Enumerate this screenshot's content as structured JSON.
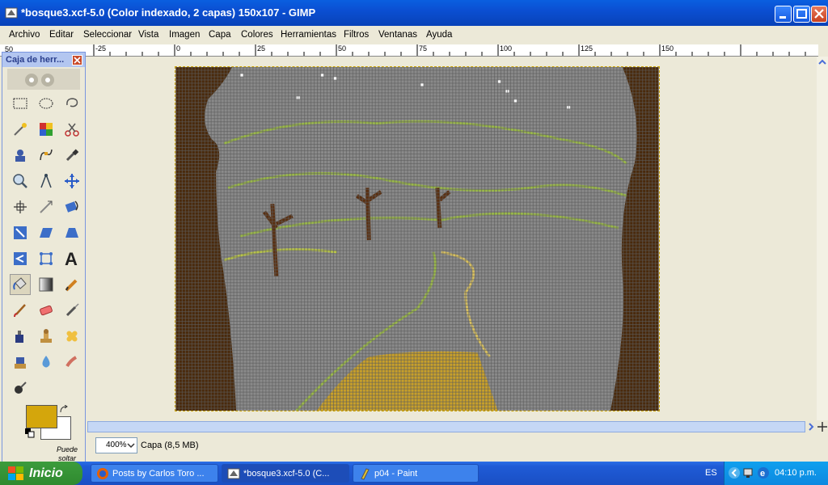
{
  "window": {
    "title": "*bosque3.xcf-5.0 (Color indexado, 2 capas) 150x107 - GIMP"
  },
  "menubar": {
    "items": [
      "Archivo",
      "Editar",
      "Seleccionar",
      "Vista",
      "Imagen",
      "Capa",
      "Colores",
      "Herramientas",
      "Filtros",
      "Ventanas",
      "Ayuda"
    ]
  },
  "ruler": {
    "ticks": [
      "-25",
      "0",
      "25",
      "50",
      "75",
      "100",
      "125",
      "150"
    ]
  },
  "vruler": {
    "label": "50"
  },
  "toolbox": {
    "title": "Caja de herr...",
    "drop_hint": "Puede soltar",
    "fg_color": "#d4a60c",
    "bg_color": "#ffffff"
  },
  "status": {
    "zoom": "400%",
    "layer_info": "Capa (8,5 MB)"
  },
  "taskbar": {
    "start_label": "Inicio",
    "tasks": [
      {
        "label": "Posts by Carlos Toro ..."
      },
      {
        "label": "*bosque3.xcf-5.0 (C..."
      },
      {
        "label": "p04 - Paint"
      }
    ],
    "lang": "ES",
    "clock": "04:10 p.m."
  },
  "colors": {
    "tree": "#4a2a0c",
    "trunk": "#5a2f10",
    "gray": "#8a8a8a",
    "path": "#c8a02a",
    "green": "#9ab84a"
  }
}
